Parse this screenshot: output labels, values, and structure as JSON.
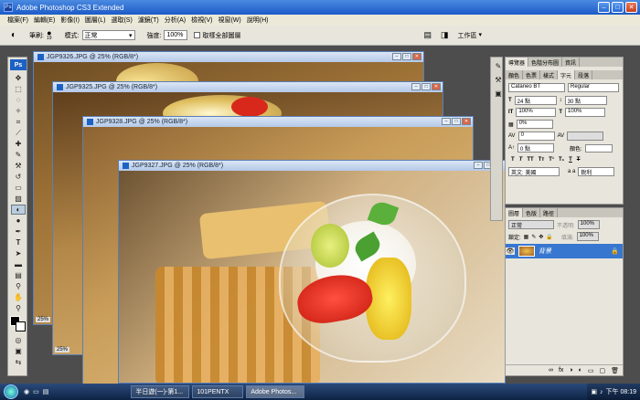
{
  "app": {
    "title": "Adobe Photoshop CS3 Extended",
    "logo": "Ps"
  },
  "menu": [
    "檔案(F)",
    "編輯(E)",
    "影像(I)",
    "圖層(L)",
    "選取(S)",
    "濾鏡(T)",
    "分析(A)",
    "檢視(V)",
    "視窗(W)",
    "說明(H)"
  ],
  "options": {
    "brush_label": "筆刷:",
    "brush_size": "19",
    "mode_label": "模式:",
    "mode_value": "正常",
    "opacity_label": "強度:",
    "opacity_value": "100%",
    "sample_all": "取樣全部圖層",
    "workspace": "工作區"
  },
  "documents": [
    {
      "title": "JGP9326.JPG @ 25% (RGB/8*)",
      "zoom": "25%"
    },
    {
      "title": "JGP9325.JPG @ 25% (RGB/8*)",
      "zoom": "25%"
    },
    {
      "title": "JGP9328.JPG @ 25% (RGB/8*)",
      "zoom": "25%"
    },
    {
      "title": "JGP9327.JPG @ 25% (RGB/8*)",
      "zoom": "25%"
    }
  ],
  "char_panel": {
    "tabs_top": [
      "導覽器",
      "色階分布圖",
      "資訊"
    ],
    "tabs": [
      "顏色",
      "色票",
      "樣式",
      "字元",
      "段落"
    ],
    "font": "Cataneo BT",
    "style": "Regular",
    "size": "24 點",
    "leading": "30 點",
    "vscale": "100%",
    "hscale": "100%",
    "baseline": "0%",
    "tracking": "0",
    "kerning": "0 點",
    "color_label": "顏色:",
    "lang": "英文: 美國",
    "aa_label": "a a",
    "aa_value": "銳利"
  },
  "layers_panel": {
    "tabs": [
      "圖層",
      "色版",
      "路徑"
    ],
    "blend": "正常",
    "opacity_label": "不透明:",
    "opacity": "100%",
    "lock_label": "鎖定:",
    "fill_label": "填滿:",
    "fill": "100%",
    "layer_name": "背景"
  },
  "taskbar": {
    "items": [
      "半日遊(一)-第1...",
      "101PENTX",
      "Adobe Photos..."
    ],
    "clock": "下午 08:19"
  },
  "colors": {
    "accent": "#1c62c4"
  }
}
